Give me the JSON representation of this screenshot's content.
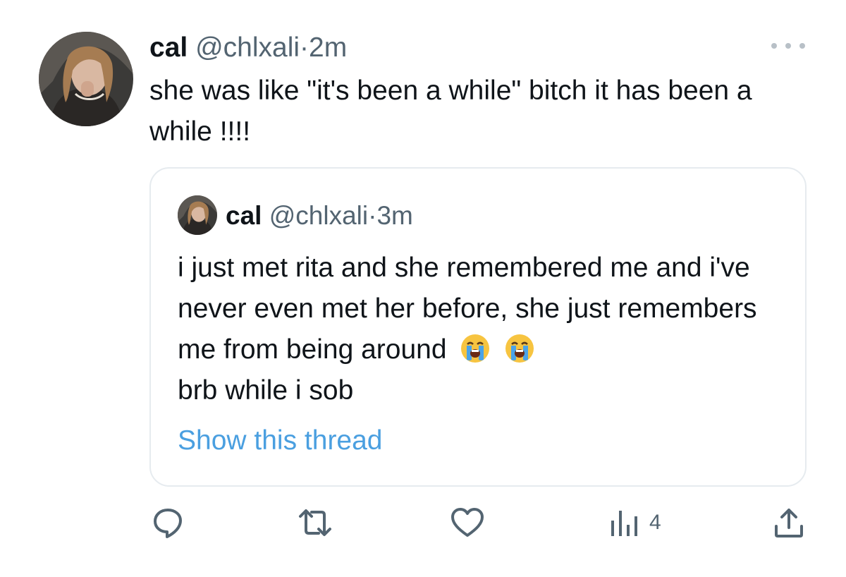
{
  "tweet": {
    "name": "cal",
    "handle": "@chlxali",
    "separator": "·",
    "time": "2m",
    "text": "she was like \"it's been a while\" bitch it has been a while !!!!"
  },
  "quote": {
    "name": "cal",
    "handle": "@chlxali",
    "separator": "·",
    "time": "3m",
    "text": "i just met rita and she remembered me and i've never even met her before, she just remembers me from being around",
    "text_end": "brb while i sob",
    "emojis": [
      "loudly-crying-face",
      "loudly-crying-face"
    ],
    "show_thread": "Show this thread"
  },
  "actions": {
    "reply_icon": "reply-icon",
    "retweet_icon": "retweet-icon",
    "like_icon": "heart-icon",
    "views_icon": "views-icon",
    "views_count": "4",
    "share_icon": "share-icon"
  },
  "colors": {
    "text": "#0f1419",
    "secondary": "#536471",
    "link": "#4a9fe0",
    "border": "#e6ebef"
  }
}
